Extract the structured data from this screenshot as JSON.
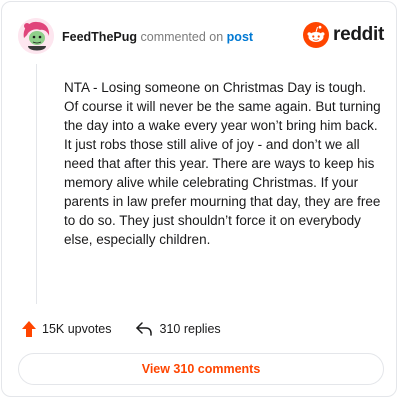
{
  "header": {
    "avatar_icon": "user-avatar-pink-hair-character",
    "username": "FeedThePug",
    "action_text": "commented on",
    "post_link": "post",
    "brand_icon": "reddit-snoo-icon",
    "brand_name": "reddit"
  },
  "comment": {
    "body": "NTA - Losing someone on Christmas Day is tough. Of course it will never be the same again. But turning the day into a wake every year won’t bring him back. It just robs those still alive of joy - and don’t we all need that after this year. There are ways to keep his memory alive while celebrating Christmas. If your parents in law prefer mourning that day, they are free to do so. They just shouldn’t force it on everybody else, especially children."
  },
  "footer": {
    "upvote_icon": "upvote-arrow-icon",
    "upvotes": "15K upvotes",
    "reply_icon": "reply-arrow-icon",
    "replies": "310 replies"
  },
  "view_button": {
    "label": "View 310 comments"
  },
  "colors": {
    "accent": "#ff4500",
    "link": "#0079d3",
    "border": "#e4e6ea",
    "muted": "#7c7c7c",
    "text": "#1a1a1b"
  }
}
